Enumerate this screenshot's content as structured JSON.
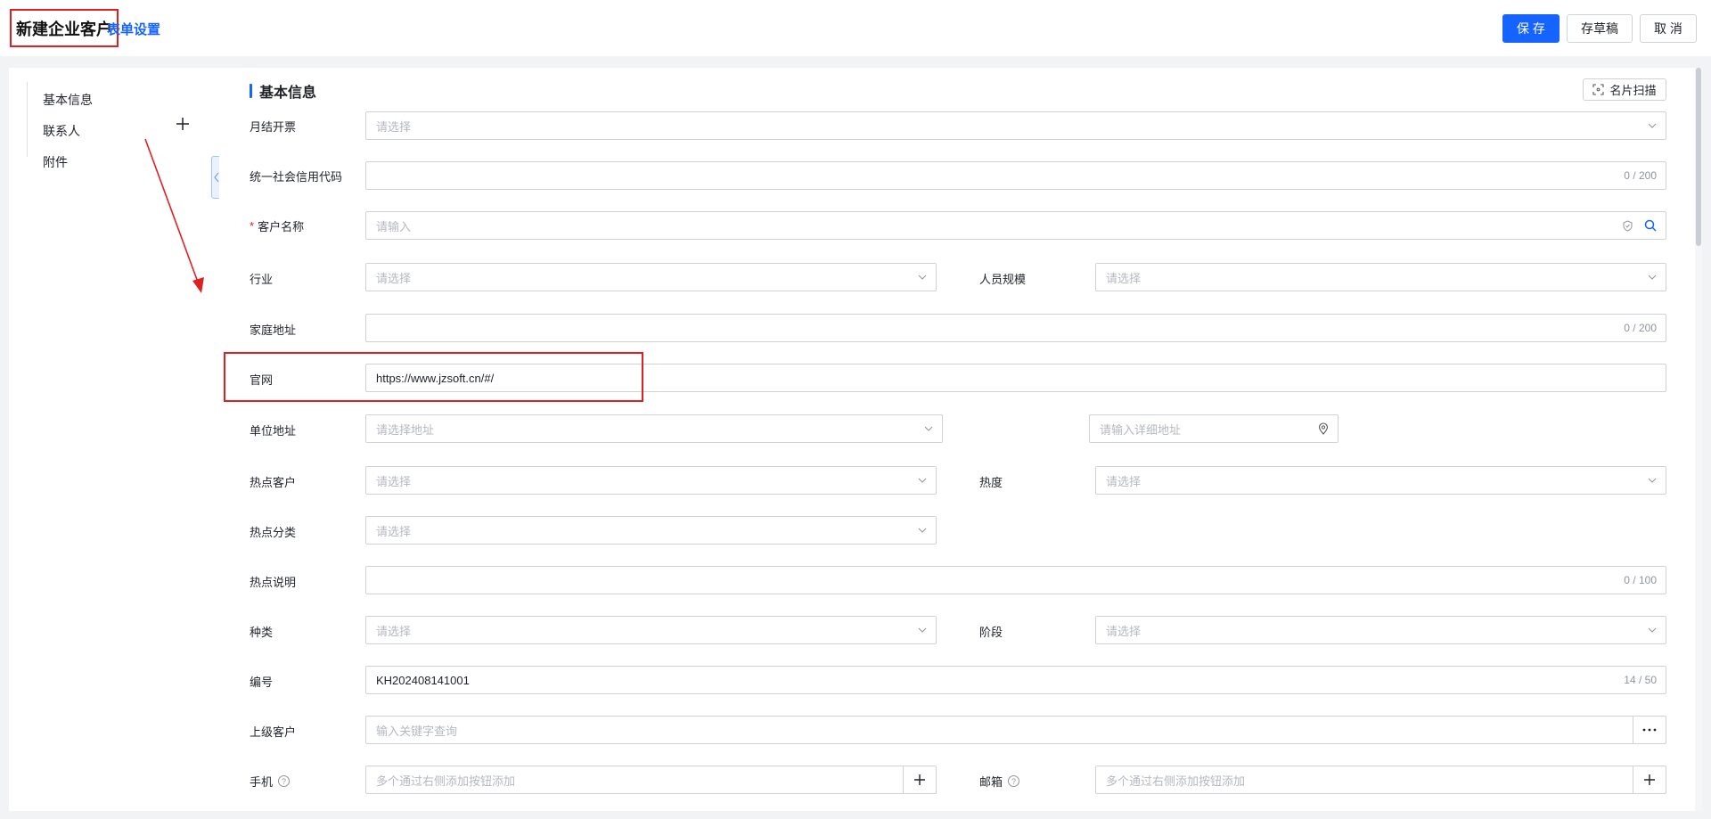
{
  "header": {
    "title": "新建企业客户",
    "form_settings": "表单设置",
    "save": "保 存",
    "draft": "存草稿",
    "cancel": "取 消"
  },
  "nav": {
    "items": [
      "基本信息",
      "联系人",
      "附件"
    ]
  },
  "section": {
    "title": "基本信息",
    "scan_button": "名片扫描"
  },
  "fields": {
    "monthly_invoice": {
      "label": "月结开票",
      "placeholder": "请选择"
    },
    "credit_code": {
      "label": "统一社会信用代码",
      "counter": "0 / 200"
    },
    "customer_name": {
      "label": "客户名称",
      "required_mark": "*",
      "placeholder": "请输入"
    },
    "industry": {
      "label": "行业",
      "placeholder": "请选择"
    },
    "staff_size": {
      "label": "人员规模",
      "placeholder": "请选择"
    },
    "home_address": {
      "label": "家庭地址",
      "counter": "0 / 200"
    },
    "website": {
      "label": "官网",
      "value": "https://www.jzsoft.cn/#/"
    },
    "company_address": {
      "label": "单位地址",
      "placeholder": "请选择地址",
      "detail_placeholder": "请输入详细地址"
    },
    "hot_customer": {
      "label": "热点客户",
      "placeholder": "请选择"
    },
    "heat": {
      "label": "热度",
      "placeholder": "请选择"
    },
    "hot_category": {
      "label": "热点分类",
      "placeholder": "请选择"
    },
    "hot_description": {
      "label": "热点说明",
      "counter": "0 / 100"
    },
    "kind": {
      "label": "种类",
      "placeholder": "请选择"
    },
    "stage": {
      "label": "阶段",
      "placeholder": "请选择"
    },
    "number": {
      "label": "编号",
      "value": "KH202408141001",
      "counter": "14 / 50"
    },
    "parent_customer": {
      "label": "上级客户",
      "placeholder": "输入关键字查询"
    },
    "mobile": {
      "label": "手机",
      "placeholder": "多个通过右侧添加按钮添加"
    },
    "email": {
      "label": "邮箱",
      "placeholder": "多个通过右侧添加按钮添加"
    }
  },
  "colors": {
    "accent": "#1664ff",
    "annotation_red": "#e02020"
  }
}
